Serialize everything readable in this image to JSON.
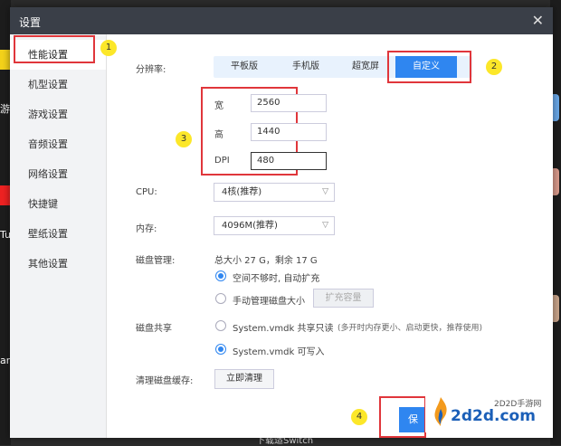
{
  "dialog": {
    "title": "设置",
    "close_glyph": "✕"
  },
  "sidebar": {
    "items": [
      {
        "label": "性能设置"
      },
      {
        "label": "机型设置"
      },
      {
        "label": "游戏设置"
      },
      {
        "label": "音频设置"
      },
      {
        "label": "网络设置"
      },
      {
        "label": "快捷键"
      },
      {
        "label": "壁纸设置"
      },
      {
        "label": "其他设置"
      }
    ]
  },
  "annotations": {
    "m1": "1",
    "m2": "2",
    "m3": "3",
    "m4": "4"
  },
  "resolution": {
    "label": "分辨率:",
    "options": [
      "平板版",
      "手机版",
      "超宽屏",
      "自定义"
    ],
    "selected": "自定义"
  },
  "custom": {
    "width_label": "宽",
    "width_value": "2560",
    "height_label": "高",
    "height_value": "1440",
    "dpi_label": "DPI",
    "dpi_value": "480"
  },
  "cpu": {
    "label": "CPU:",
    "value": "4核(推荐)"
  },
  "memory": {
    "label": "内存:",
    "value": "4096M(推荐)"
  },
  "disk": {
    "label": "磁盘管理:",
    "summary": "总大小 27 G，剩余 17 G",
    "auto_label": "空间不够时, 自动扩充",
    "manual_label": "手动管理磁盘大小",
    "expand_button": "扩充容量",
    "auto_selected": true
  },
  "share": {
    "label": "磁盘共享",
    "readonly_label": "System.vmdk 共享只读",
    "readonly_hint": "(多开时内存更小、启动更快，推荐使用)",
    "writable_label": "System.vmdk 可写入",
    "writable_selected": true
  },
  "cache": {
    "label": "清理磁盘缓存:",
    "button": "立即清理"
  },
  "footer": {
    "save_fragment": "保"
  },
  "watermark": {
    "top": "2D2D手游网",
    "big": "2d2d.com"
  },
  "background": {
    "left_fragments": [
      "游双",
      "Tu",
      "am"
    ],
    "bottom_fragment": "下载适Switch"
  },
  "colors": {
    "accent": "#2f86f0",
    "annotation_red": "#e0363b",
    "marker_yellow": "#fce729",
    "titlebar": "#3a3f48"
  }
}
